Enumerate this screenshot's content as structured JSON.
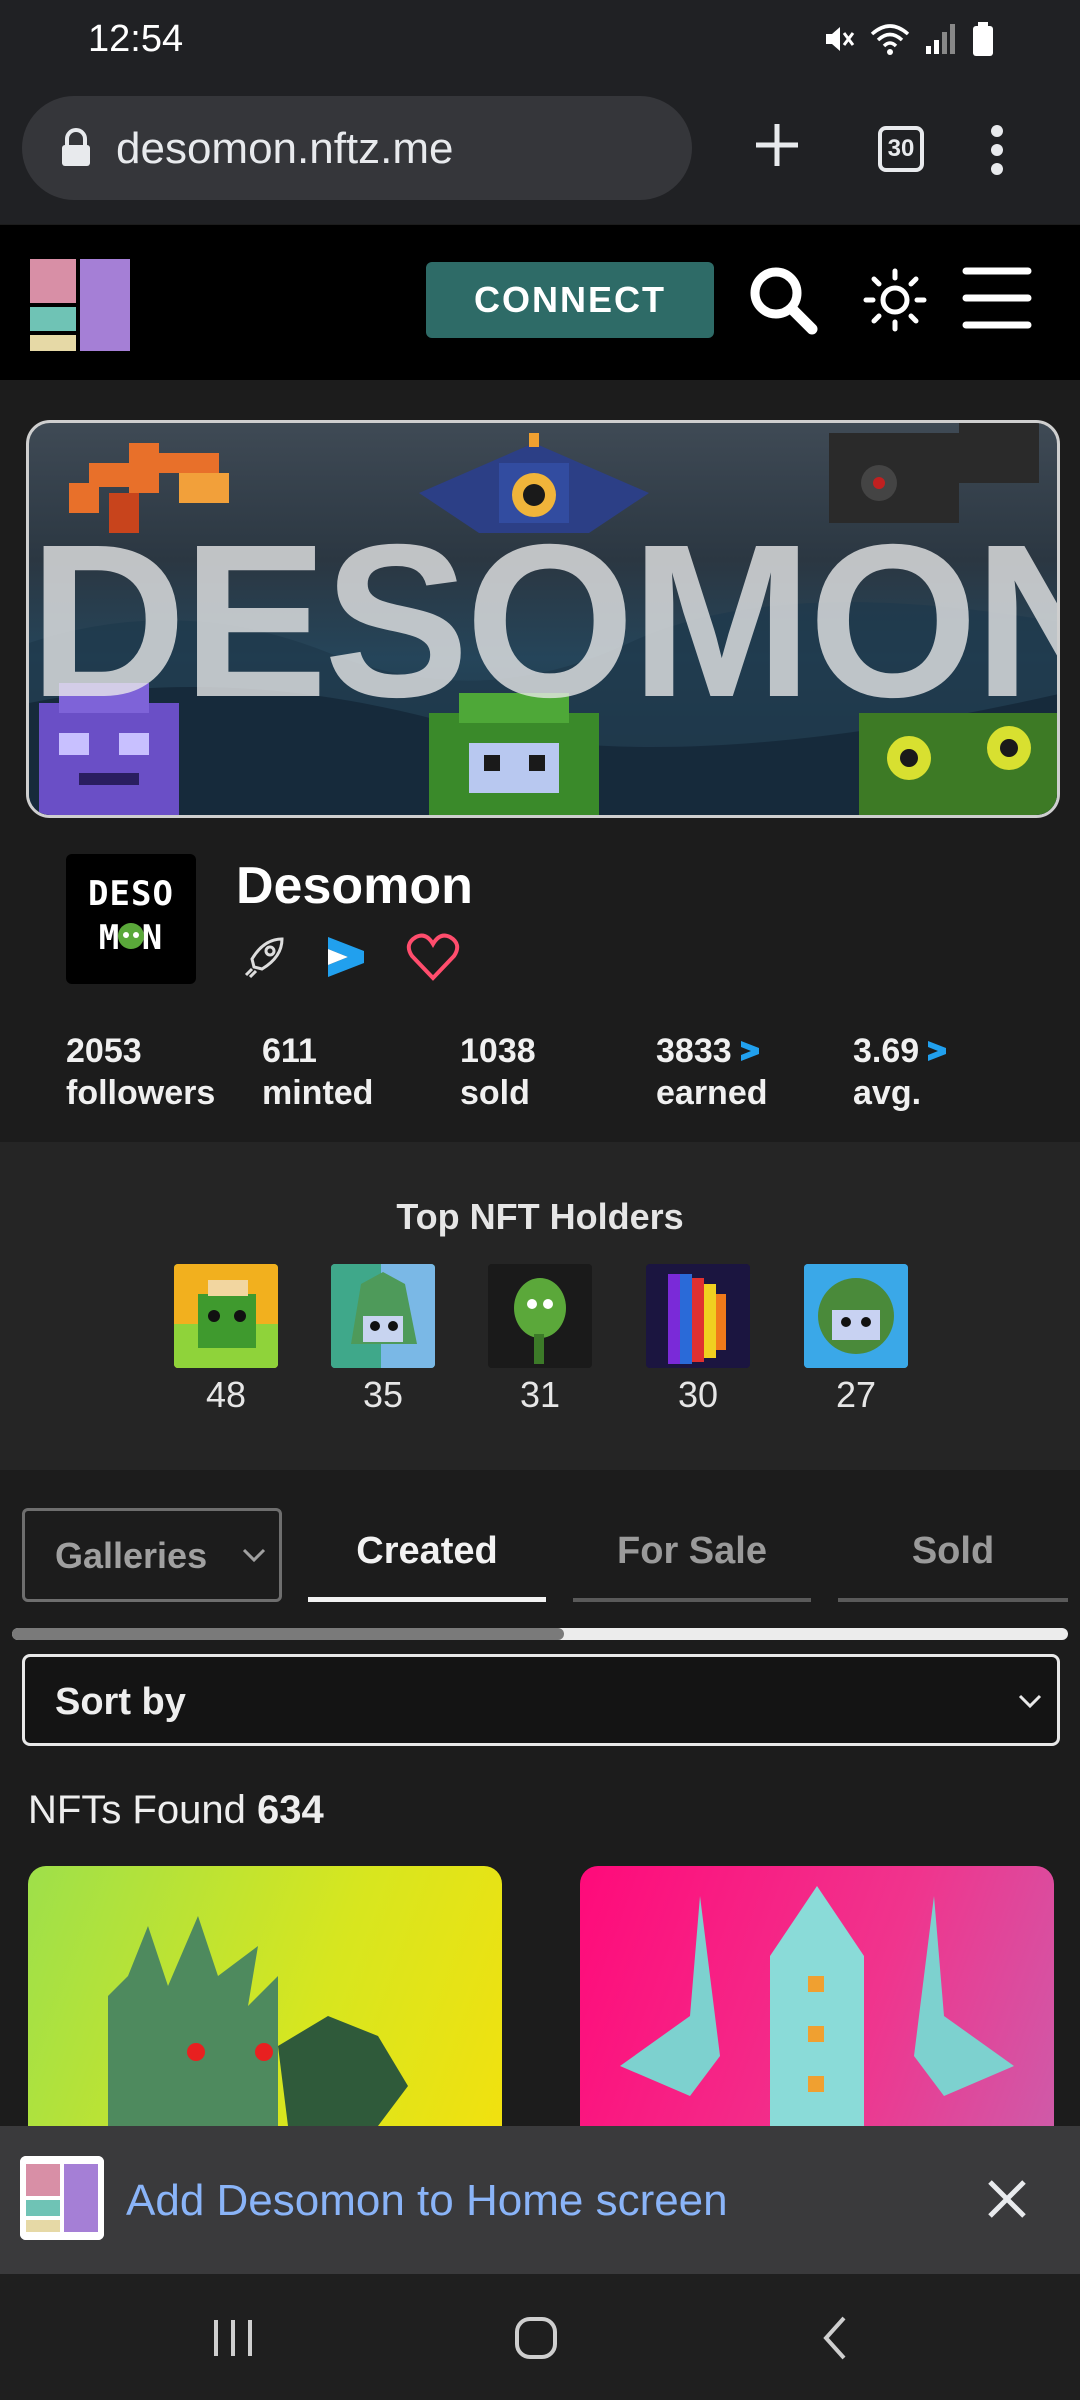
{
  "status": {
    "time": "12:54",
    "icons": [
      "mute-icon",
      "wifi-icon",
      "signal-icon",
      "battery-icon"
    ]
  },
  "browser": {
    "url": "desomon.nftz.me",
    "tab_count": "30",
    "icons": [
      "lock-icon",
      "plus-icon",
      "tabs-icon",
      "more-vertical-icon"
    ]
  },
  "header": {
    "connect_label": "CONNECT",
    "icons": [
      "search-icon",
      "theme-sun-icon",
      "hamburger-menu-icon"
    ]
  },
  "banner": {
    "title": "DESOMON"
  },
  "profile": {
    "avatar_text_line1": "DESO",
    "avatar_text_line2": "M N",
    "name": "Desomon",
    "icons": [
      "rocket-icon",
      "deso-logo-icon",
      "heart-icon"
    ]
  },
  "stats": [
    {
      "value": "2053",
      "label": "followers"
    },
    {
      "value": "611",
      "label": "minted"
    },
    {
      "value": "1038",
      "label": "sold"
    },
    {
      "value": "3833",
      "label": "earned"
    },
    {
      "value": "3.69",
      "label": "avg."
    }
  ],
  "holders": {
    "title": "Top NFT Holders",
    "items": [
      {
        "count": "48",
        "bg": "#8fd33a"
      },
      {
        "count": "35",
        "bg": "#6fb3c8"
      },
      {
        "count": "31",
        "bg": "#1a1a1a"
      },
      {
        "count": "30",
        "bg": "#1b1540"
      },
      {
        "count": "27",
        "bg": "#3aa8e8"
      }
    ]
  },
  "tabs": {
    "galleries": "Galleries",
    "created": "Created",
    "for_sale": "For Sale",
    "sold": "Sold"
  },
  "sort": {
    "label": "Sort by"
  },
  "found": {
    "label": "NFTs Found",
    "count": "634"
  },
  "install": {
    "text": "Add Desomon to Home screen"
  },
  "colors": {
    "connect": "#2e6b67",
    "link_blue": "#8ab4f8",
    "deso_blue": "#21a0ee",
    "heart": "#ff4d6d"
  }
}
